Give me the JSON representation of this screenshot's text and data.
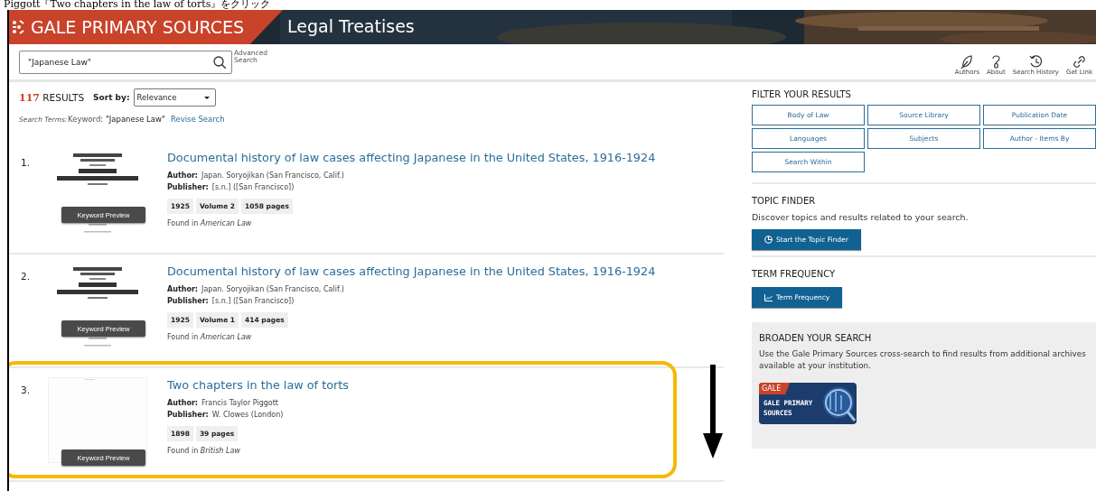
{
  "caption": "Piggott『Two chapters in the law of torts』をクリック",
  "header": {
    "brand": "GALE PRIMARY SOURCES",
    "collection": "Legal Treatises"
  },
  "search": {
    "value": "\"Japanese Law\"",
    "advanced": "Advanced Search"
  },
  "toolbar": [
    {
      "label": "Authors"
    },
    {
      "label": "About"
    },
    {
      "label": "Search History"
    },
    {
      "label": "Get Link"
    }
  ],
  "summary": {
    "count": "117",
    "label": "RESULTS",
    "sort_label": "Sort by:",
    "sort_value": "Relevance"
  },
  "search_terms": {
    "label": "Search Terms:",
    "keyword_label": "Keyword:",
    "keyword": "\"Japanese Law\"",
    "revise": "Revise Search"
  },
  "results": [
    {
      "number": "1.",
      "title": "Documental history of law cases affecting Japanese in the United States, 1916-1924",
      "author_label": "Author:",
      "author": "Japan. Soryojikan (San Francisco, Calif.)",
      "publisher_label": "Publisher:",
      "publisher": "[s.n.] ([San Francisco])",
      "tags": [
        "1925",
        "Volume 2",
        "1058 pages"
      ],
      "found_prefix": "Found in",
      "found_in": "American Law",
      "preview": "Keyword Preview",
      "highlighted": false
    },
    {
      "number": "2.",
      "title": "Documental history of law cases affecting Japanese in the United States, 1916-1924",
      "author_label": "Author:",
      "author": "Japan. Soryojikan (San Francisco, Calif.)",
      "publisher_label": "Publisher:",
      "publisher": "[s.n.] ([San Francisco])",
      "tags": [
        "1925",
        "Volume 1",
        "414 pages"
      ],
      "found_prefix": "Found in",
      "found_in": "American Law",
      "preview": "Keyword Preview",
      "highlighted": false
    },
    {
      "number": "3.",
      "title": "Two chapters in the law of torts",
      "author_label": "Author:",
      "author": "Francis Taylor Piggott",
      "publisher_label": "Publisher:",
      "publisher": "W. Clowes (London)",
      "tags": [
        "1898",
        "39 pages"
      ],
      "found_prefix": "Found in",
      "found_in": "British Law",
      "preview": "Keyword Preview",
      "highlighted": true
    }
  ],
  "filters": {
    "title": "FILTER YOUR RESULTS",
    "buttons": [
      "Body of Law",
      "Source Library",
      "Publication Date",
      "Languages",
      "Subjects",
      "Author - Items By",
      "Search Within"
    ]
  },
  "topic_finder": {
    "title": "TOPIC FINDER",
    "text": "Discover topics and results related to your search.",
    "button": "Start the Topic Finder"
  },
  "term_frequency": {
    "title": "TERM FREQUENCY",
    "button": "Term Frequency"
  },
  "broaden": {
    "title": "BROADEN YOUR SEARCH",
    "text": "Use the Gale Primary Sources cross-search to find results from additional archives available at your institution.",
    "logo_badge": "GALE",
    "logo_name": "GALE PRIMARY SOURCES"
  }
}
